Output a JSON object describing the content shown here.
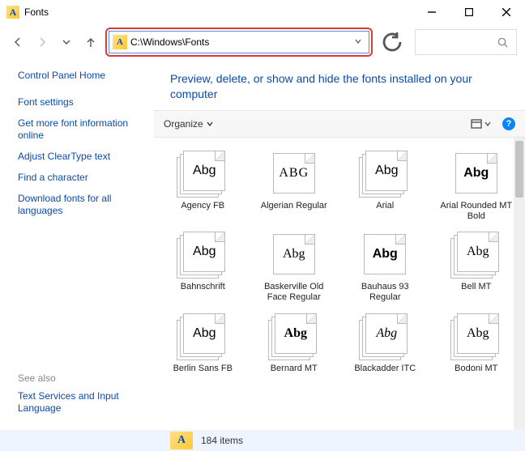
{
  "window": {
    "title": "Fonts"
  },
  "address": {
    "path": "C:\\Windows\\Fonts"
  },
  "sidebar": {
    "links": [
      "Control Panel Home",
      "Font settings",
      "Get more font information online",
      "Adjust ClearType text",
      "Find a character",
      "Download fonts for all languages"
    ],
    "see_also_label": "See also",
    "see_also_links": [
      "Text Services and Input Language"
    ]
  },
  "heading": "Preview, delete, or show and hide the fonts installed on your computer",
  "toolbar": {
    "organize": "Organize"
  },
  "fonts": [
    {
      "name": "Agency FB",
      "sample": "Abg",
      "style": "font-family:'Agency FB',sans-serif;font-stretch:condensed;",
      "stack": true
    },
    {
      "name": "Algerian Regular",
      "sample": "ABG",
      "style": "font-family:Algerian,serif;letter-spacing:1px;",
      "stack": false
    },
    {
      "name": "Arial",
      "sample": "Abg",
      "style": "font-family:Arial,sans-serif;",
      "stack": true
    },
    {
      "name": "Arial Rounded MT Bold",
      "sample": "Abg",
      "style": "font-family:'Arial Rounded MT Bold',Arial,sans-serif;font-weight:bold;",
      "stack": false
    },
    {
      "name": "Bahnschrift",
      "sample": "Abg",
      "style": "font-family:Bahnschrift,sans-serif;",
      "stack": true
    },
    {
      "name": "Baskerville Old Face Regular",
      "sample": "Abg",
      "style": "font-family:'Baskerville Old Face',Baskerville,serif;",
      "stack": false
    },
    {
      "name": "Bauhaus 93 Regular",
      "sample": "Abg",
      "style": "font-family:'Bauhaus 93',sans-serif;font-weight:bold;",
      "stack": false
    },
    {
      "name": "Bell MT",
      "sample": "Abg",
      "style": "font-family:'Bell MT',serif;",
      "stack": true
    },
    {
      "name": "Berlin Sans FB",
      "sample": "Abg",
      "style": "font-family:'Berlin Sans FB',sans-serif;",
      "stack": true
    },
    {
      "name": "Bernard MT",
      "sample": "Abg",
      "style": "font-family:'Bernard MT Condensed',serif;font-weight:bold;",
      "stack": true
    },
    {
      "name": "Blackadder ITC",
      "sample": "Abg",
      "style": "font-family:'Blackadder ITC',cursive;font-style:italic;",
      "stack": true
    },
    {
      "name": "Bodoni MT",
      "sample": "Abg",
      "style": "font-family:'Bodoni MT',serif;",
      "stack": true
    }
  ],
  "status": {
    "count": "184 items"
  }
}
